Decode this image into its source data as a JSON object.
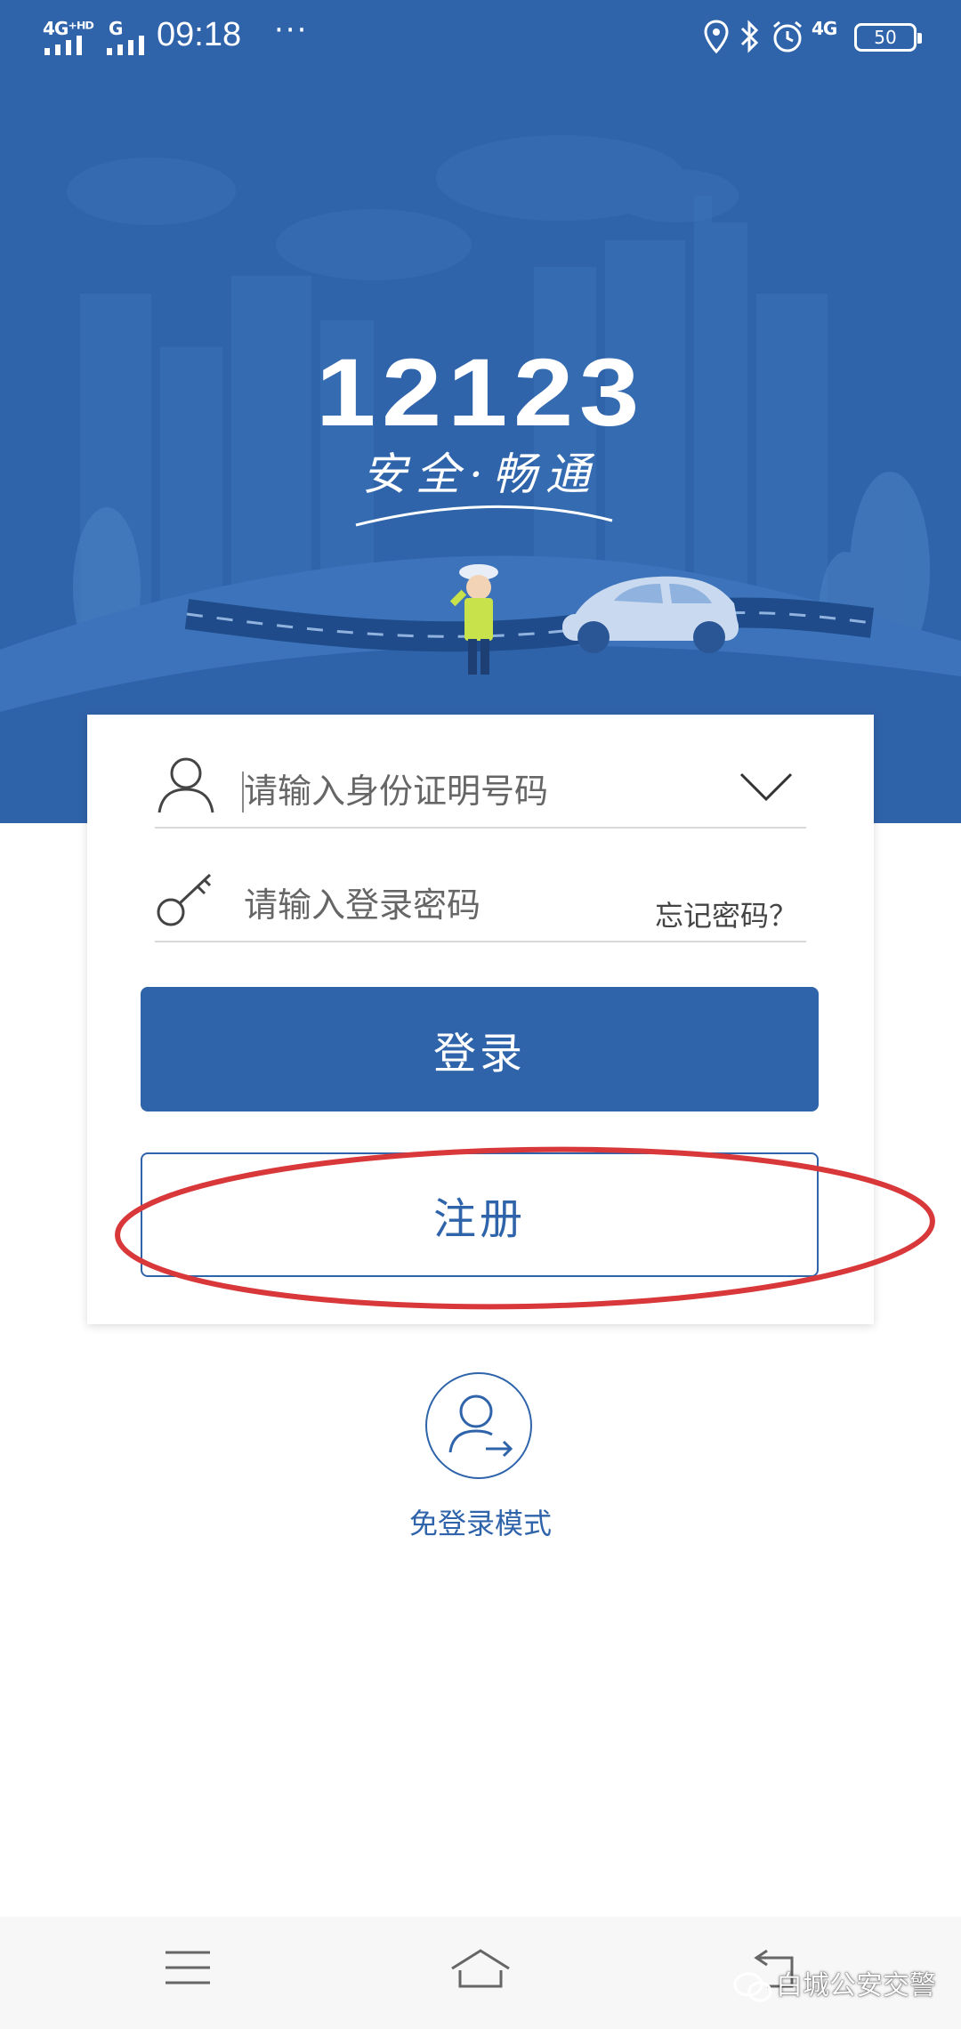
{
  "status_bar": {
    "net_left": "4G⁺ᴴᴰ",
    "net_second": "G",
    "time": "09:18",
    "more": "···",
    "net_right": "4G",
    "battery": "50"
  },
  "hero": {
    "logo": "12123",
    "slogan": "安全·畅通"
  },
  "login_form": {
    "id_placeholder": "请输入身份证明号码",
    "password_placeholder": "请输入登录密码",
    "forgot_password": "忘记密码？",
    "login_button": "登录",
    "register_button": "注册"
  },
  "guest": {
    "label": "免登录模式"
  },
  "watermark": {
    "text": "白城公安交警"
  },
  "colors": {
    "brand_blue": "#2f64ab",
    "highlight_red": "#d9383a"
  },
  "icons": [
    "user-icon",
    "key-icon",
    "chevron-down-icon",
    "guest-user-icon",
    "menu-icon",
    "home-icon",
    "back-icon"
  ]
}
